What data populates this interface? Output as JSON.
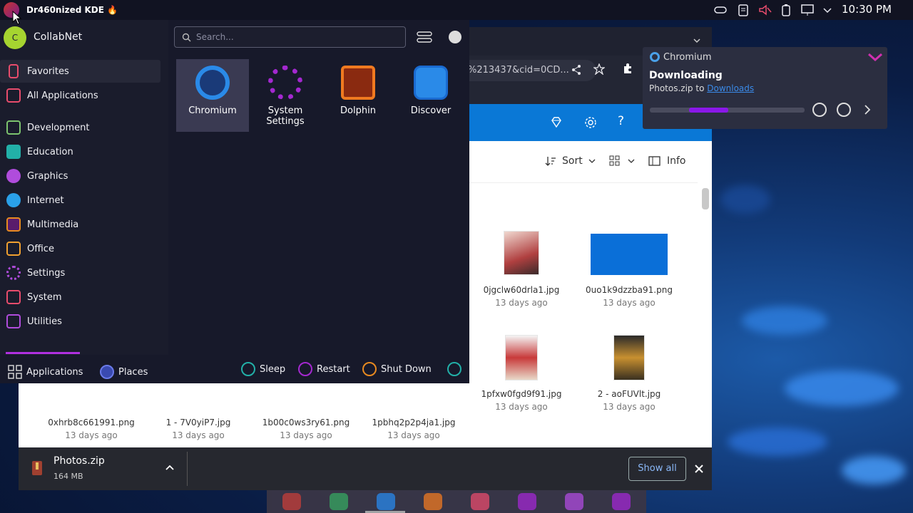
{
  "topbar": {
    "title": "Dr460nized KDE 🔥",
    "clock": "10:30 PM"
  },
  "launcher": {
    "user": {
      "initial": "C",
      "name": "CollabNet"
    },
    "search_placeholder": "Search...",
    "categories": [
      {
        "label": "Favorites",
        "icon": "bookmark-icon",
        "color": "#e84c6c"
      },
      {
        "label": "All Applications",
        "icon": "grid-icon",
        "color": "#e84c6c"
      },
      {
        "label": "Development",
        "icon": "development-icon",
        "color": "#7cc36e"
      },
      {
        "label": "Education",
        "icon": "education-icon",
        "color": "#22b0a8"
      },
      {
        "label": "Graphics",
        "icon": "graphics-icon",
        "color": "#b04cdc"
      },
      {
        "label": "Internet",
        "icon": "internet-icon",
        "color": "#2aa0e8"
      },
      {
        "label": "Multimedia",
        "icon": "multimedia-icon",
        "color": "#e88a20"
      },
      {
        "label": "Office",
        "icon": "office-icon",
        "color": "#f0a030"
      },
      {
        "label": "Settings",
        "icon": "settings-icon",
        "color": "#b04cdc"
      },
      {
        "label": "System",
        "icon": "system-icon",
        "color": "#e84c6c"
      },
      {
        "label": "Utilities",
        "icon": "utilities-icon",
        "color": "#b04cdc"
      }
    ],
    "apps": [
      {
        "label": "Chromium",
        "icon": "chromium-icon",
        "color": "#2a8ae8"
      },
      {
        "label": "System Settings",
        "icon": "system-settings-icon",
        "color": "#a428d0"
      },
      {
        "label": "Dolphin",
        "icon": "dolphin-icon",
        "color": "#f07a20"
      },
      {
        "label": "Discover",
        "icon": "discover-icon",
        "color": "#2a8ae8"
      }
    ],
    "tabs": {
      "applications": "Applications",
      "places": "Places"
    },
    "power": {
      "sleep": "Sleep",
      "restart": "Restart",
      "shutdown": "Shut Down"
    }
  },
  "browser": {
    "url": "%213437&cid=0CD...",
    "toolbar": {
      "sort": "Sort",
      "info": "Info"
    },
    "files_row1": [
      {
        "name": "0jgclw60drla1.jpg",
        "date": "13 days ago"
      },
      {
        "name": "0uo1k9dzzba91.png",
        "date": "13 days ago"
      }
    ],
    "files_row2": [
      {
        "name": "1pfxw0fgd9f91.jpg",
        "date": "13 days ago"
      },
      {
        "name": "2 - aoFUVlt.jpg",
        "date": "13 days ago"
      }
    ],
    "files_row_partial": [
      {
        "name": "0xhrb8c661991.png",
        "date": "13 days ago"
      },
      {
        "name": "1 - 7V0yiP7.jpg",
        "date": "13 days ago"
      },
      {
        "name": "1b00c0ws3ry61.png",
        "date": "13 days ago"
      },
      {
        "name": "1pbhq2p2p4ja1.jpg",
        "date": "13 days ago"
      }
    ]
  },
  "download_bar": {
    "file": "Photos.zip",
    "size": "164 MB",
    "show_all": "Show all"
  },
  "notification": {
    "app": "Chromium",
    "title": "Downloading",
    "body_prefix": "Photos.zip to",
    "body_link": "Downloads",
    "progress": 0.5
  },
  "colors": {
    "accent": "#8a2be2",
    "blue": "#0a78d6"
  }
}
